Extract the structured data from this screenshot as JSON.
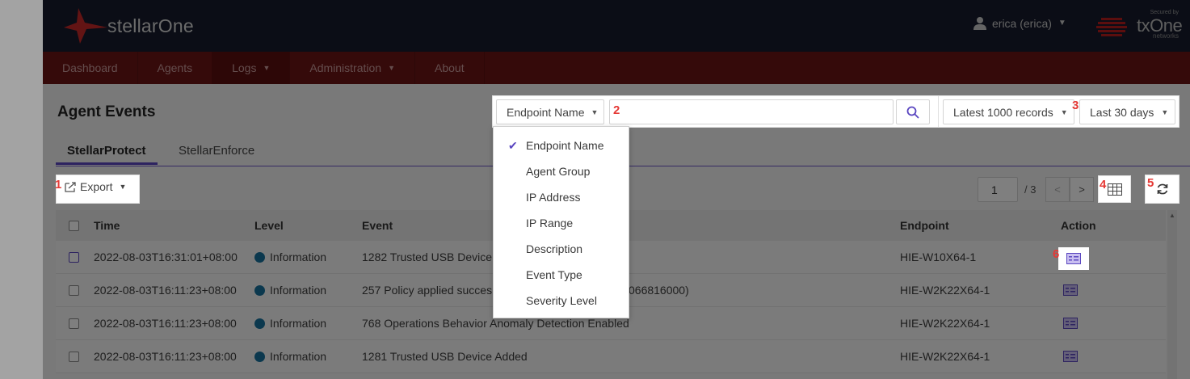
{
  "app": {
    "brand": "stellarOne",
    "user_label": "erica (erica)",
    "secured_by": "Secured by",
    "partner_name": "txOne",
    "partner_sub": "networks",
    "accent": "#5a46c0",
    "nav_color": "#6b1515"
  },
  "nav": {
    "items": [
      {
        "label": "Dashboard"
      },
      {
        "label": "Agents"
      },
      {
        "label": "Logs"
      },
      {
        "label": "Administration"
      },
      {
        "label": "About"
      }
    ]
  },
  "page": {
    "title": "Agent Events"
  },
  "filter": {
    "field_label": "Endpoint Name",
    "search_value": "",
    "search_icon": "search-icon",
    "options": [
      "Endpoint Name",
      "Agent Group",
      "IP Address",
      "IP Range",
      "Description",
      "Event Type",
      "Severity Level"
    ],
    "selected": "Endpoint Name"
  },
  "range": {
    "records": "Latest 1000 records",
    "period": "Last 30 days"
  },
  "tabs": [
    {
      "label": "StellarProtect"
    },
    {
      "label": "StellarEnforce"
    }
  ],
  "toolbar": {
    "export_label": "Export",
    "page_current": "1",
    "page_total": "/ 3",
    "prev": "<",
    "next": ">"
  },
  "badges": {
    "b1": "1",
    "b2": "2",
    "b3": "3",
    "b4": "4",
    "b5": "5",
    "b6": "6"
  },
  "table": {
    "headers": {
      "time": "Time",
      "level": "Level",
      "event": "Event",
      "endpoint": "Endpoint",
      "action": "Action"
    },
    "rows": [
      {
        "time": "2022-08-03T16:31:01+08:00",
        "level": "Information",
        "event": "1282 Trusted USB Device",
        "endpoint": "HIE-W10X64-1"
      },
      {
        "time": "2022-08-03T16:11:23+08:00",
        "level": "Information",
        "event": "257 Policy applied succes",
        "event_tail": "066816000)",
        "endpoint": "HIE-W2K22X64-1"
      },
      {
        "time": "2022-08-03T16:11:23+08:00",
        "level": "Information",
        "event": "768 Operations Behavior Anomaly Detection Enabled",
        "endpoint": "HIE-W2K22X64-1"
      },
      {
        "time": "2022-08-03T16:11:23+08:00",
        "level": "Information",
        "event": "1281 Trusted USB Device Added",
        "endpoint": "HIE-W2K22X64-1"
      }
    ]
  }
}
